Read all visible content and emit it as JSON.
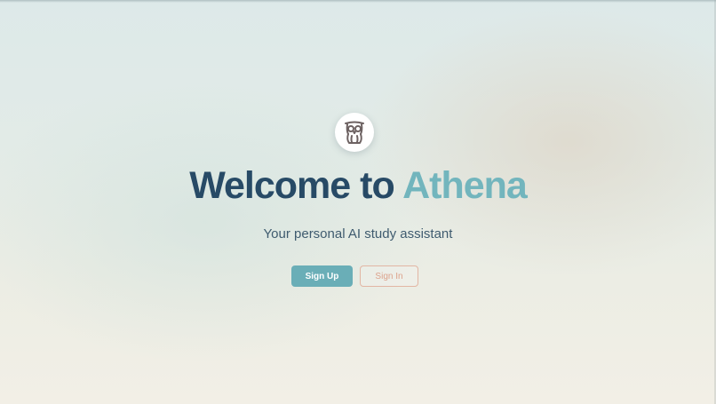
{
  "hero": {
    "logo_icon": "owl-icon",
    "title_main": "Welcome to",
    "title_accent": "Athena",
    "subtitle": "Your personal AI study assistant"
  },
  "actions": {
    "sign_up_label": "Sign Up",
    "sign_in_label": "Sign In"
  },
  "colors": {
    "title": "#274a66",
    "accent": "#72b5bd",
    "primary_button": "#6aaeb7",
    "secondary_button_text": "#dca28c",
    "secondary_button_border": "#e2b6a4"
  }
}
